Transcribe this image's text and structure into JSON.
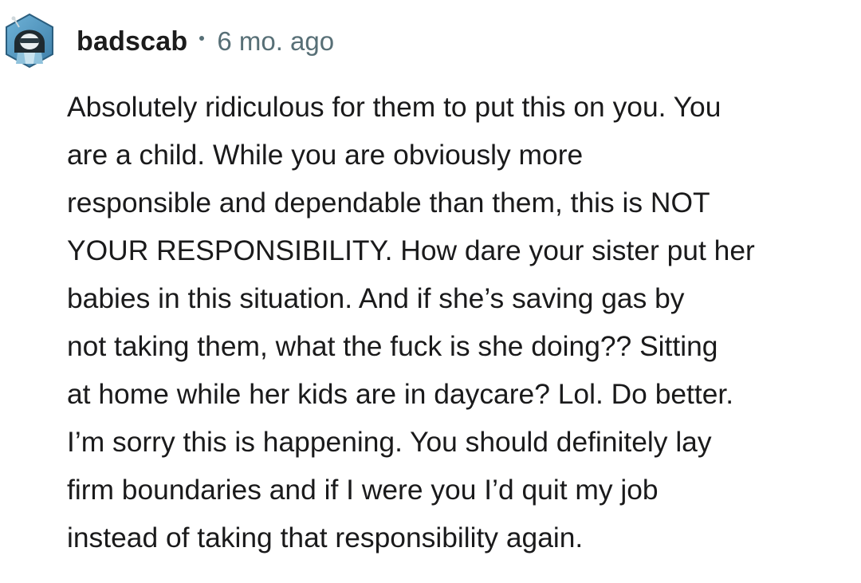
{
  "comment": {
    "author": "badscab",
    "separator": "•",
    "timestamp": "6 mo. ago",
    "avatar_icon": "user-avatar-icon",
    "body": "Absolutely ridiculous for them to put this on you. You\nare a child. While you are obviously more\nresponsible and dependable than them, this is NOT\nYOUR RESPONSIBILITY. How dare your sister put her\nbabies in this situation. And if she’s saving gas by\nnot taking them, what the fuck is she doing?? Sitting\nat home while her kids are in daycare? Lol. Do better.\nI’m sorry this is happening. You should definitely lay\nfirm boundaries and if I were you I’d quit my job\ninstead of taking that responsibility again."
  },
  "colors": {
    "text": "#1a1a1b",
    "meta": "#576f76",
    "avatar_bg": "#4f8fb8"
  }
}
